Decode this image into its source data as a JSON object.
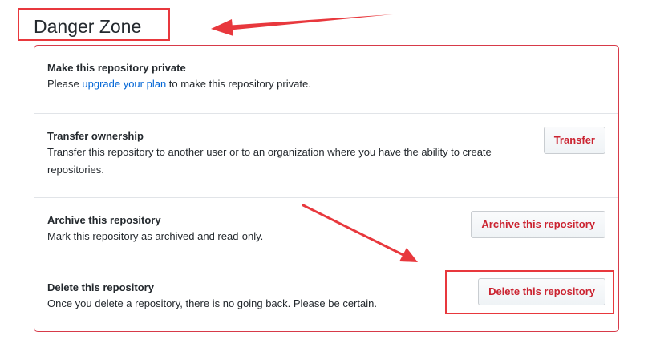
{
  "header": {
    "title": "Danger Zone"
  },
  "danger_zone": {
    "items": [
      {
        "title": "Make this repository private",
        "desc_prefix": "Please ",
        "desc_link": "upgrade your plan",
        "desc_suffix": " to make this repository private."
      },
      {
        "title": "Transfer ownership",
        "desc_line1": "Transfer this repository to another user or to an organization where you have the ability to create",
        "desc_line2": "repositories.",
        "button": "Transfer"
      },
      {
        "title": "Archive this repository",
        "desc": "Mark this repository as archived and read-only.",
        "button": "Archive this repository"
      },
      {
        "title": "Delete this repository",
        "desc": "Once you delete a repository, there is no going back. Please be certain.",
        "button": "Delete this repository"
      }
    ]
  },
  "colors": {
    "danger_red": "#cb2431",
    "panel_border": "#d73a49",
    "annotation_red": "#e8383d",
    "link_blue": "#0366d6"
  }
}
